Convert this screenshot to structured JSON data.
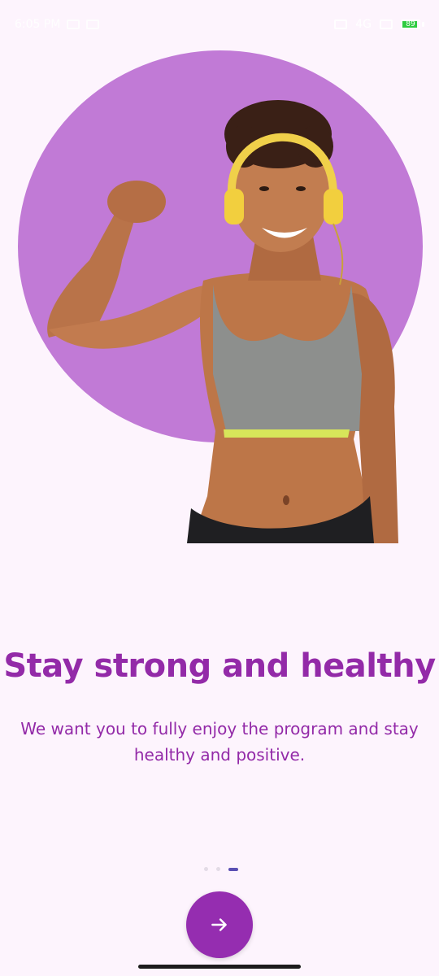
{
  "status_bar": {
    "time": "6:05 PM",
    "battery_level": "89",
    "network": "4G"
  },
  "onboarding": {
    "title": "Stay strong and healthy",
    "subtitle": "We want you to fully enjoy the program and stay healthy and positive.",
    "page_count": 3,
    "current_page": 3
  },
  "colors": {
    "background": "#fdf4fd",
    "accent": "#932aa8",
    "circle": "#c17ad6",
    "button": "#952db0",
    "active_dot": "#5a4fb3"
  },
  "icons": {
    "next": "arrow-right-icon"
  }
}
